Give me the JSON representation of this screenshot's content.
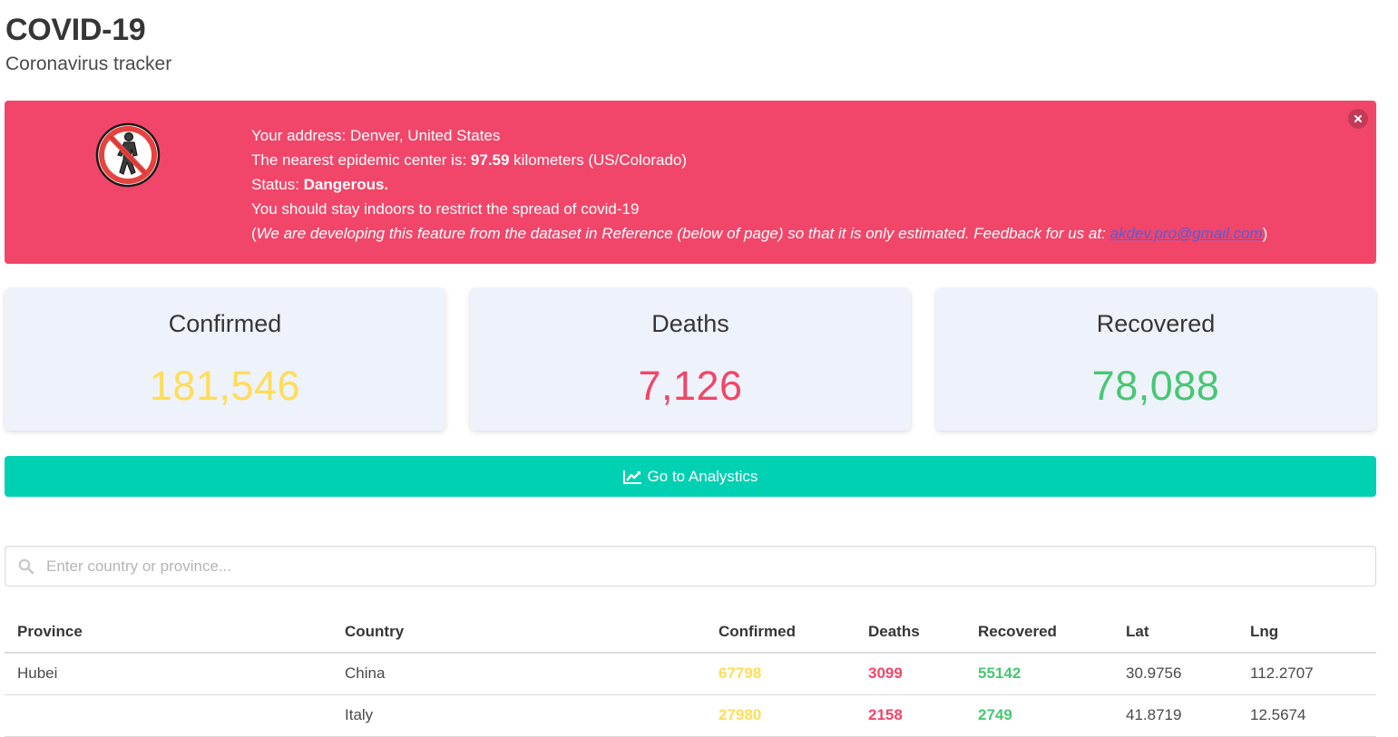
{
  "header": {
    "title": "COVID-19",
    "subtitle": "Coronavirus tracker"
  },
  "alert": {
    "icon": "no-pedestrian-icon",
    "address_label": "Your address: ",
    "address": "Denver, United States",
    "nearest_prefix": "The nearest epidemic center is: ",
    "nearest_km": "97.59",
    "nearest_suffix": " kilometers (US/Colorado)",
    "status_label": "Status: ",
    "status": "Dangerous.",
    "advice": "You should stay indoors to restrict the spread of covid-19",
    "note_open": "(",
    "note": "We are developing this feature from the dataset in Reference (below of page) so that it is only estimated. Feedback for us at: ",
    "email": "akdev.pro@gmail.com",
    "note_close": ")",
    "background_color": "#f1466a"
  },
  "stats": {
    "confirmed": {
      "label": "Confirmed",
      "value": "181,546",
      "color": "#ffdd57"
    },
    "deaths": {
      "label": "Deaths",
      "value": "7,126",
      "color": "#f14668"
    },
    "recovered": {
      "label": "Recovered",
      "value": "78,088",
      "color": "#48c774"
    }
  },
  "analytics_button": {
    "icon": "line-chart-icon",
    "label": "Go to Analystics",
    "color": "#00d1b2"
  },
  "search": {
    "icon": "search-icon",
    "placeholder": "Enter country or province...",
    "value": ""
  },
  "table": {
    "headers": [
      "Province",
      "Country",
      "Confirmed",
      "Deaths",
      "Recovered",
      "Lat",
      "Lng"
    ],
    "rows": [
      [
        "Hubei",
        "China",
        "67798",
        "3099",
        "55142",
        "30.9756",
        "112.2707"
      ],
      [
        "",
        "Italy",
        "27980",
        "2158",
        "2749",
        "41.8719",
        "12.5674"
      ]
    ]
  }
}
